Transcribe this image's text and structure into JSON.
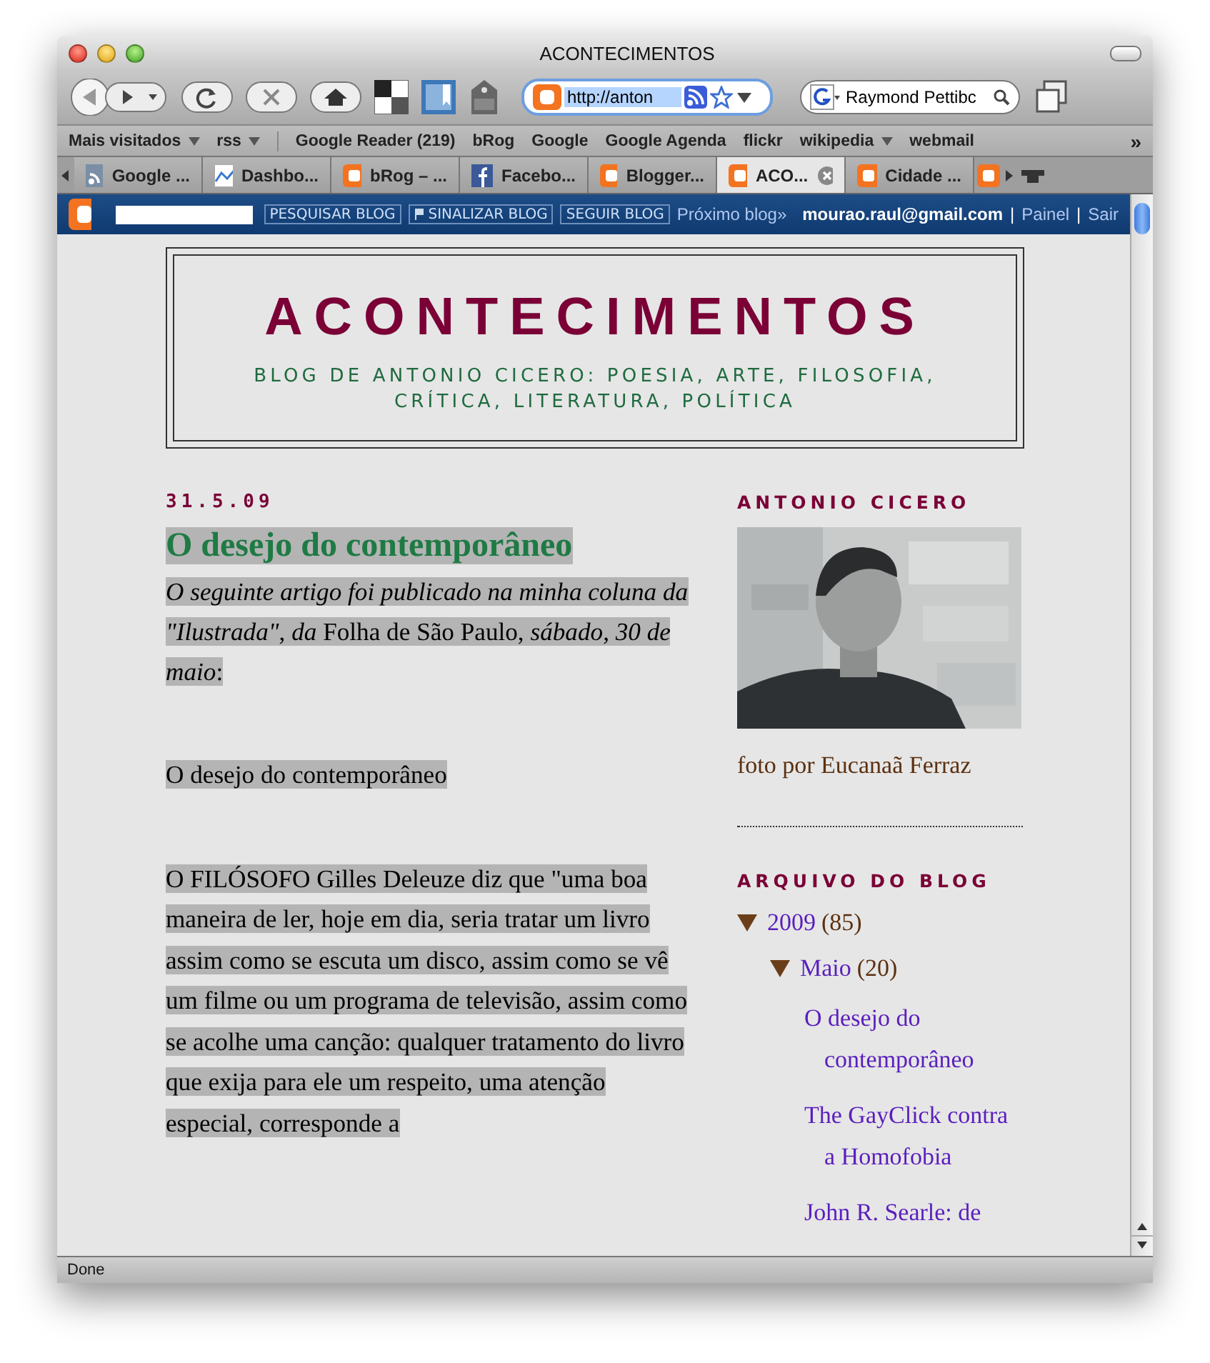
{
  "window": {
    "title": "ACONTECIMENTOS"
  },
  "toolbar": {
    "url": "http://anton",
    "search": "Raymond Pettibc"
  },
  "bookmarks": [
    {
      "label": "Mais visitados",
      "dropdown": true
    },
    {
      "label": "rss",
      "dropdown": true
    },
    {
      "label": "Google Reader (219)",
      "dropdown": false
    },
    {
      "label": "bRog",
      "dropdown": false
    },
    {
      "label": "Google",
      "dropdown": false
    },
    {
      "label": "Google Agenda",
      "dropdown": false
    },
    {
      "label": "flickr",
      "dropdown": false
    },
    {
      "label": "wikipedia",
      "dropdown": true
    },
    {
      "label": "webmail",
      "dropdown": false
    }
  ],
  "bookmarks_overflow": "»",
  "tabs": [
    {
      "label": "Google ...",
      "kind": "feed",
      "selected": false
    },
    {
      "label": "Dashbo...",
      "kind": "chart",
      "selected": false
    },
    {
      "label": "bRog – ...",
      "kind": "blogger",
      "selected": false
    },
    {
      "label": "Facebo...",
      "kind": "facebook",
      "selected": false
    },
    {
      "label": "Blogger...",
      "kind": "blogger",
      "selected": false
    },
    {
      "label": "ACO...",
      "kind": "blogger",
      "selected": true
    },
    {
      "label": "Cidade ...",
      "kind": "blogger",
      "selected": false
    }
  ],
  "navbar": {
    "buttons": [
      "PESQUISAR BLOG",
      "SINALIZAR BLOG",
      "SEGUIR BLOG"
    ],
    "next": "Próximo blog»",
    "email": "mourao.raul@gmail.com",
    "links": [
      "Painel",
      "Sair"
    ],
    "separator": "|"
  },
  "blog": {
    "title": "ACONTECIMENTOS",
    "description": "BLOG DE ANTONIO CICERO: POESIA, ARTE, FILOSOFIA, CRÍTICA, LITERATURA, POLÍTICA"
  },
  "post": {
    "date": "31.5.09",
    "title": "O desejo do contemporâneo",
    "selected": true,
    "intro": "*O seguinte artigo foi publicado na minha coluna da \"Ilustrada\"*, *da* Folha de São Paulo, *sábado*, *30 de maio*:",
    "paragraphs": [
      "O desejo do contemporâneo",
      "O FILÓSOFO Gilles Deleuze diz que \"uma boa maneira de ler, hoje em dia, seria tratar um livro assim como se escuta um disco, assim como se vê um filme ou um programa de televisão, assim como se acolhe uma canção: qualquer tratamento do livro que exija para ele um respeito, uma atenção especial, corresponde a"
    ]
  },
  "sidebar": {
    "profile_heading": "ANTONIO CICERO",
    "photo_caption": "foto por Eucanaã Ferraz",
    "archive_heading": "ARQUIVO DO BLOG",
    "archive": [
      {
        "label": "2009",
        "count": "(85)",
        "expanded": true,
        "children": [
          {
            "label": "Maio",
            "count": "(20)",
            "expanded": true,
            "children": [
              {
                "label": "O desejo do contemporâneo"
              },
              {
                "label": "The GayClick contra a Homofobia"
              },
              {
                "label": "John R. Searle: de"
              }
            ]
          }
        ]
      }
    ]
  },
  "status_bar": "Done"
}
